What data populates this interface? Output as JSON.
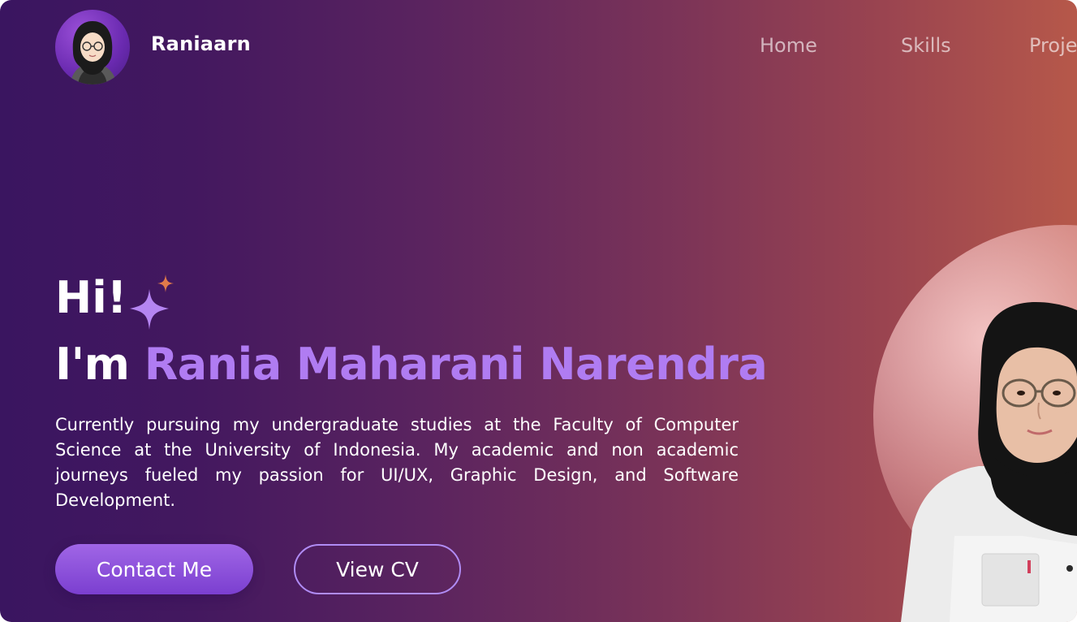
{
  "nav": {
    "brand": "Raniaarn",
    "links": [
      "Home",
      "Skills",
      "Proje"
    ]
  },
  "hero": {
    "greeting": "Hi!",
    "intro_prefix": "I'm",
    "name": "Rania Maharani Narendra",
    "description": "Currently pursuing my undergraduate studies at the Faculty of Computer Science at the University of Indonesia. My academic and non academic journeys fueled my passion for UI/UX, Graphic Design, and Software Development.",
    "buttons": {
      "contact": "Contact Me",
      "cv": "View CV"
    }
  },
  "colors": {
    "accent": "#b07cf2",
    "button_primary": "#8a4fdc",
    "sparkle_purple": "#b585f2",
    "sparkle_orange": "#e07a4a"
  }
}
